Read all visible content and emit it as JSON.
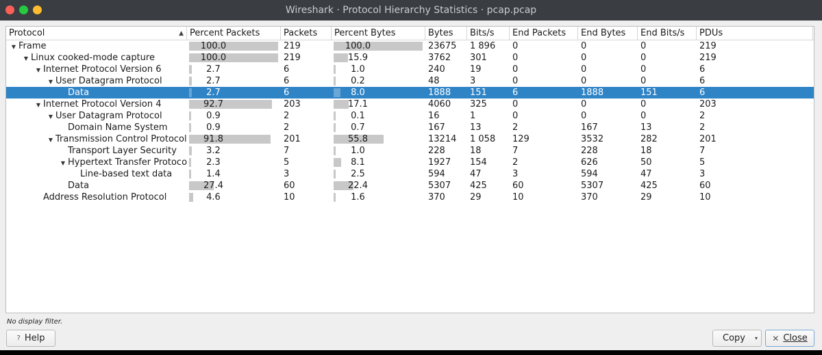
{
  "window": {
    "title": "Wireshark · Protocol Hierarchy Statistics · pcap.pcap"
  },
  "columns": [
    "Protocol",
    "Percent Packets",
    "Packets",
    "Percent Bytes",
    "Bytes",
    "Bits/s",
    "End Packets",
    "End Bytes",
    "End Bits/s",
    "PDUs"
  ],
  "sort": {
    "column": "Protocol",
    "direction": "ascending"
  },
  "rows": [
    {
      "depth": 0,
      "expanded": true,
      "protocol": "Frame",
      "pct_packets": "100.0",
      "packets": "219",
      "pct_bytes": "100.0",
      "bytes": "23675",
      "bits_s": "1 896",
      "end_packets": "0",
      "end_bytes": "0",
      "end_bits_s": "0",
      "pdus": "219",
      "selected": false
    },
    {
      "depth": 1,
      "expanded": true,
      "protocol": "Linux cooked-mode capture",
      "pct_packets": "100.0",
      "packets": "219",
      "pct_bytes": "15.9",
      "bytes": "3762",
      "bits_s": "301",
      "end_packets": "0",
      "end_bytes": "0",
      "end_bits_s": "0",
      "pdus": "219",
      "selected": false
    },
    {
      "depth": 2,
      "expanded": true,
      "protocol": "Internet Protocol Version 6",
      "pct_packets": "2.7",
      "packets": "6",
      "pct_bytes": "1.0",
      "bytes": "240",
      "bits_s": "19",
      "end_packets": "0",
      "end_bytes": "0",
      "end_bits_s": "0",
      "pdus": "6",
      "selected": false
    },
    {
      "depth": 3,
      "expanded": true,
      "protocol": "User Datagram Protocol",
      "pct_packets": "2.7",
      "packets": "6",
      "pct_bytes": "0.2",
      "bytes": "48",
      "bits_s": "3",
      "end_packets": "0",
      "end_bytes": "0",
      "end_bits_s": "0",
      "pdus": "6",
      "selected": false
    },
    {
      "depth": 4,
      "expanded": null,
      "protocol": "Data",
      "pct_packets": "2.7",
      "packets": "6",
      "pct_bytes": "8.0",
      "bytes": "1888",
      "bits_s": "151",
      "end_packets": "6",
      "end_bytes": "1888",
      "end_bits_s": "151",
      "pdus": "6",
      "selected": true
    },
    {
      "depth": 2,
      "expanded": true,
      "protocol": "Internet Protocol Version 4",
      "pct_packets": "92.7",
      "packets": "203",
      "pct_bytes": "17.1",
      "bytes": "4060",
      "bits_s": "325",
      "end_packets": "0",
      "end_bytes": "0",
      "end_bits_s": "0",
      "pdus": "203",
      "selected": false
    },
    {
      "depth": 3,
      "expanded": true,
      "protocol": "User Datagram Protocol",
      "pct_packets": "0.9",
      "packets": "2",
      "pct_bytes": "0.1",
      "bytes": "16",
      "bits_s": "1",
      "end_packets": "0",
      "end_bytes": "0",
      "end_bits_s": "0",
      "pdus": "2",
      "selected": false
    },
    {
      "depth": 4,
      "expanded": null,
      "protocol": "Domain Name System",
      "pct_packets": "0.9",
      "packets": "2",
      "pct_bytes": "0.7",
      "bytes": "167",
      "bits_s": "13",
      "end_packets": "2",
      "end_bytes": "167",
      "end_bits_s": "13",
      "pdus": "2",
      "selected": false
    },
    {
      "depth": 3,
      "expanded": true,
      "protocol": "Transmission Control Protocol",
      "pct_packets": "91.8",
      "packets": "201",
      "pct_bytes": "55.8",
      "bytes": "13214",
      "bits_s": "1 058",
      "end_packets": "129",
      "end_bytes": "3532",
      "end_bits_s": "282",
      "pdus": "201",
      "selected": false
    },
    {
      "depth": 4,
      "expanded": null,
      "protocol": "Transport Layer Security",
      "pct_packets": "3.2",
      "packets": "7",
      "pct_bytes": "1.0",
      "bytes": "228",
      "bits_s": "18",
      "end_packets": "7",
      "end_bytes": "228",
      "end_bits_s": "18",
      "pdus": "7",
      "selected": false
    },
    {
      "depth": 4,
      "expanded": true,
      "protocol": "Hypertext Transfer Protocol",
      "pct_packets": "2.3",
      "packets": "5",
      "pct_bytes": "8.1",
      "bytes": "1927",
      "bits_s": "154",
      "end_packets": "2",
      "end_bytes": "626",
      "end_bits_s": "50",
      "pdus": "5",
      "selected": false
    },
    {
      "depth": 5,
      "expanded": null,
      "protocol": "Line-based text data",
      "pct_packets": "1.4",
      "packets": "3",
      "pct_bytes": "2.5",
      "bytes": "594",
      "bits_s": "47",
      "end_packets": "3",
      "end_bytes": "594",
      "end_bits_s": "47",
      "pdus": "3",
      "selected": false
    },
    {
      "depth": 4,
      "expanded": null,
      "protocol": "Data",
      "pct_packets": "27.4",
      "packets": "60",
      "pct_bytes": "22.4",
      "bytes": "5307",
      "bits_s": "425",
      "end_packets": "60",
      "end_bytes": "5307",
      "end_bits_s": "425",
      "pdus": "60",
      "selected": false
    },
    {
      "depth": 2,
      "expanded": null,
      "protocol": "Address Resolution Protocol",
      "pct_packets": "4.6",
      "packets": "10",
      "pct_bytes": "1.6",
      "bytes": "370",
      "bits_s": "29",
      "end_packets": "10",
      "end_bytes": "370",
      "end_bits_s": "29",
      "pdus": "10",
      "selected": false
    }
  ],
  "status": {
    "filter_text": "No display filter."
  },
  "buttons": {
    "help": "Help",
    "copy": "Copy",
    "close": "Close"
  },
  "colors": {
    "selection": "#2f84c6",
    "titlebar": "#3a3e42",
    "bar": "#c8c8c8"
  },
  "icons": {
    "expanded": "triangle-down",
    "help": "question-mark",
    "close": "x-mark",
    "dropdown": "chevron-down"
  }
}
